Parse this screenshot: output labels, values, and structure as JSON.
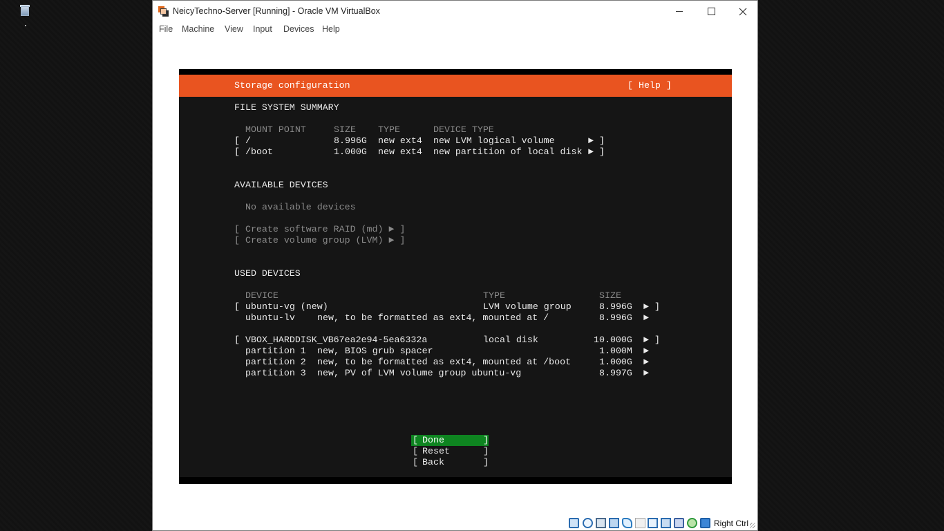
{
  "window": {
    "title": "NeicyTechno-Server [Running] - Oracle VM VirtualBox"
  },
  "menu": [
    "File",
    "Machine",
    "View",
    "Input",
    "Devices",
    "Help"
  ],
  "installer": {
    "header_title": "Storage configuration",
    "help_label": "[ Help ]",
    "fs_summary": {
      "heading": "FILE SYSTEM SUMMARY",
      "columns": [
        "MOUNT POINT",
        "SIZE",
        "TYPE",
        "DEVICE TYPE"
      ],
      "rows": [
        {
          "open": "[",
          "mount": "/",
          "size": "8.996G",
          "type": "new ext4",
          "device_type": "new LVM logical volume",
          "arrow": "►",
          "close": "]"
        },
        {
          "open": "[",
          "mount": "/boot",
          "size": "1.000G",
          "type": "new ext4",
          "device_type": "new partition of local disk",
          "arrow": "►",
          "close": "]"
        }
      ]
    },
    "available": {
      "heading": "AVAILABLE DEVICES",
      "none_text": "No available devices",
      "actions": [
        "[ Create software RAID (md) ► ]",
        "[ Create volume group (LVM) ► ]"
      ]
    },
    "used": {
      "heading": "USED DEVICES",
      "columns": [
        "DEVICE",
        "TYPE",
        "SIZE"
      ],
      "groups": [
        {
          "open": "[",
          "device": "ubuntu-vg (new)",
          "type": "LVM volume group",
          "size": "8.996G",
          "arrow": "►",
          "close": "]",
          "children": [
            {
              "name": "ubuntu-lv",
              "desc": "new, to be formatted as ext4, mounted at /",
              "size": "8.996G",
              "arrow": "►"
            }
          ]
        },
        {
          "open": "[",
          "device": "VBOX_HARDDISK_VB67ea2e94-5ea6332a",
          "type": "local disk",
          "size": "10.000G",
          "arrow": "►",
          "close": "]",
          "children": [
            {
              "name": "partition 1",
              "desc": "new, BIOS grub spacer",
              "size": "1.000M",
              "arrow": "►"
            },
            {
              "name": "partition 2",
              "desc": "new, to be formatted as ext4, mounted at /boot",
              "size": "1.000G",
              "arrow": "►"
            },
            {
              "name": "partition 3",
              "desc": "new, PV of LVM volume group ubuntu-vg",
              "size": "8.997G",
              "arrow": "►"
            }
          ]
        }
      ]
    },
    "buttons": [
      {
        "open": "[",
        "label": "Done",
        "close": "]"
      },
      {
        "open": "[",
        "label": "Reset",
        "close": "]"
      },
      {
        "open": "[",
        "label": "Back",
        "close": "]"
      }
    ],
    "colors": {
      "header": "#e95420",
      "selected_button": "#0e8420",
      "background": "#151515"
    }
  },
  "statusbar": {
    "icons": [
      "hard-disk-icon",
      "optical-drive-icon",
      "audio-icon",
      "network-icon",
      "usb-icon",
      "shared-folders-icon",
      "display-icon",
      "recording-icon",
      "cpu-virtualization-icon",
      "mouse-integration-icon",
      "keyboard-capture-icon"
    ],
    "host_key": "Right Ctrl"
  }
}
